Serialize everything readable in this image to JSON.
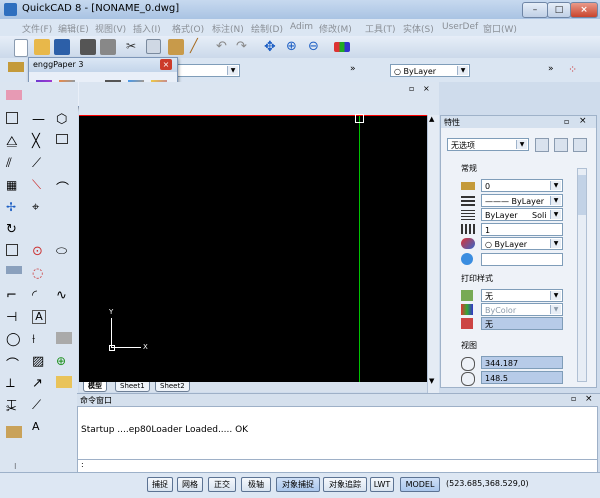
{
  "title": "QuickCAD 8 - [NONAME_0.dwg]",
  "menu": [
    "文件(F)",
    "编辑(E)",
    "视图(V)",
    "插入(I)",
    "格式(O)",
    "标注(N)",
    "绘制(D)",
    "Adim",
    "修改(M)",
    "工具(T)",
    "实体(S)",
    "UserDef",
    "窗口(W)"
  ],
  "toolbar_more": "»",
  "float": {
    "title": "enggPaper 3",
    "close": "×"
  },
  "layer_select": "ByLayer",
  "canvas": {
    "ucs_x": "X",
    "ucs_y": "Y"
  },
  "tabs": [
    "模型",
    "Sheet1",
    "Sheet2"
  ],
  "panel": {
    "title": "特性",
    "selection": "无选项",
    "group_general": "常规",
    "color": "0",
    "linetype": "ByLayer",
    "lineweight": "ByLayer",
    "linewt_suffix": "Soli",
    "scale": "1",
    "plot_color": "ByLayer",
    "group_print": "打印样式",
    "print_style": "无",
    "print_color": "ByColor",
    "print_table": "无",
    "group_view": "视图",
    "view_x": "344.187",
    "view_y": "148.5"
  },
  "cmd": {
    "title": "命令窗口",
    "text": "Startup ....ep80Loader Loaded..... OK",
    "prompt": ":"
  },
  "status": {
    "buttons": [
      "捕捉",
      "网格",
      "正交",
      "极轴",
      "对象捕捉",
      "对象追踪",
      "LWT",
      "MODEL"
    ],
    "coords": "(523.685,368.529,0)"
  },
  "colors": {
    "canvas": "#000000",
    "crosshair": "#00c000",
    "accent": "#cc0000"
  }
}
